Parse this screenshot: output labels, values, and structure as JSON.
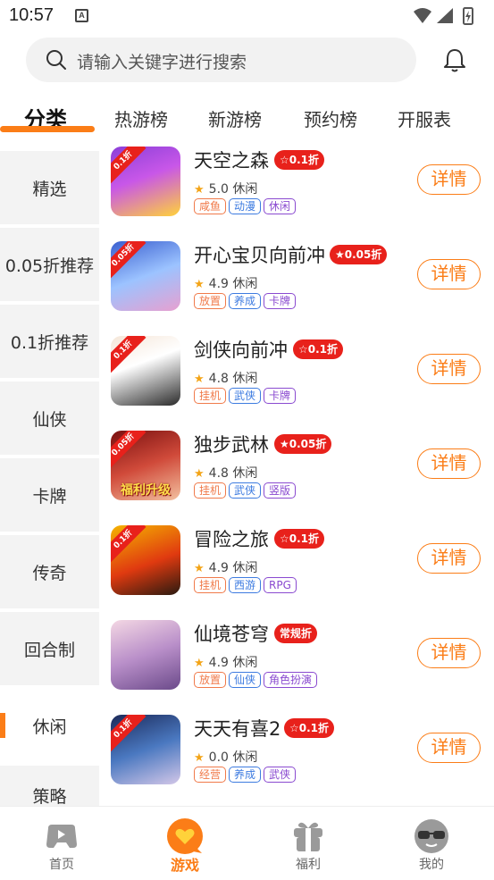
{
  "status": {
    "time": "10:57",
    "notif_letter": "A"
  },
  "search": {
    "placeholder": "请输入关键字进行搜索"
  },
  "tabs": [
    {
      "label": "分类",
      "active": true
    },
    {
      "label": "热游榜"
    },
    {
      "label": "新游榜"
    },
    {
      "label": "预约榜"
    },
    {
      "label": "开服表"
    }
  ],
  "sidebar": {
    "items": [
      {
        "label": "精选"
      },
      {
        "label": "0.05折推荐"
      },
      {
        "label": "0.1折推荐"
      },
      {
        "label": "仙侠"
      },
      {
        "label": "卡牌"
      },
      {
        "label": "传奇"
      },
      {
        "label": "回合制"
      },
      {
        "label": "休闲",
        "active": true
      },
      {
        "label": "策略"
      }
    ]
  },
  "colors": {
    "accent": "#fb7d17",
    "discount_red": "#e8211b",
    "tag_orange": "#f07a4a",
    "tag_blue": "#3d7be0",
    "tag_purple": "#8a4ad0",
    "star": "#f3a417"
  },
  "games": [
    {
      "name": "天空之森",
      "discount": "☆0.1折",
      "rating": "5.0",
      "category": "休闲",
      "tags": [
        {
          "text": "咸鱼",
          "color": "orange"
        },
        {
          "text": "动漫",
          "color": "blue"
        },
        {
          "text": "休闲",
          "color": "purple"
        }
      ],
      "icon_badge": "0.1折",
      "detail": "详情"
    },
    {
      "name": "开心宝贝向前冲",
      "discount": "★0.05折",
      "rating": "4.9",
      "category": "休闲",
      "tags": [
        {
          "text": "放置",
          "color": "orange"
        },
        {
          "text": "养成",
          "color": "blue"
        },
        {
          "text": "卡牌",
          "color": "purple"
        }
      ],
      "icon_badge": "0.05折",
      "detail": "详情"
    },
    {
      "name": "剑侠向前冲",
      "discount": "☆0.1折",
      "rating": "4.8",
      "category": "休闲",
      "tags": [
        {
          "text": "挂机",
          "color": "orange"
        },
        {
          "text": "武侠",
          "color": "blue"
        },
        {
          "text": "卡牌",
          "color": "purple"
        }
      ],
      "icon_badge": "0.1折",
      "detail": "详情"
    },
    {
      "name": "独步武林",
      "discount": "★0.05折",
      "rating": "4.8",
      "category": "休闲",
      "tags": [
        {
          "text": "挂机",
          "color": "orange"
        },
        {
          "text": "武侠",
          "color": "blue"
        },
        {
          "text": "竖版",
          "color": "purple"
        }
      ],
      "icon_badge": "0.05折",
      "icon_caption": "福利升级",
      "detail": "详情"
    },
    {
      "name": "冒险之旅",
      "discount": "☆0.1折",
      "rating": "4.9",
      "category": "休闲",
      "tags": [
        {
          "text": "挂机",
          "color": "orange"
        },
        {
          "text": "西游",
          "color": "blue"
        },
        {
          "text": "RPG",
          "color": "purple"
        }
      ],
      "icon_badge": "0.1折",
      "detail": "详情"
    },
    {
      "name": "仙境苍穹",
      "discount": "常规折",
      "rating": "4.9",
      "category": "休闲",
      "tags": [
        {
          "text": "放置",
          "color": "orange"
        },
        {
          "text": "仙侠",
          "color": "blue"
        },
        {
          "text": "角色扮演",
          "color": "purple"
        }
      ],
      "icon_badge": "",
      "detail": "详情"
    },
    {
      "name": "天天有喜2",
      "discount": "☆0.1折",
      "rating": "0.0",
      "category": "休闲",
      "tags": [
        {
          "text": "经营",
          "color": "orange"
        },
        {
          "text": "养成",
          "color": "blue"
        },
        {
          "text": "武侠",
          "color": "purple"
        }
      ],
      "icon_badge": "0.1折",
      "detail": "详情"
    }
  ],
  "bottom_nav": [
    {
      "label": "首页",
      "icon": "gamepad-icon"
    },
    {
      "label": "游戏",
      "icon": "heart-chat-icon",
      "active": true
    },
    {
      "label": "福利",
      "icon": "gift-icon"
    },
    {
      "label": "我的",
      "icon": "sunglasses-face-icon"
    }
  ]
}
